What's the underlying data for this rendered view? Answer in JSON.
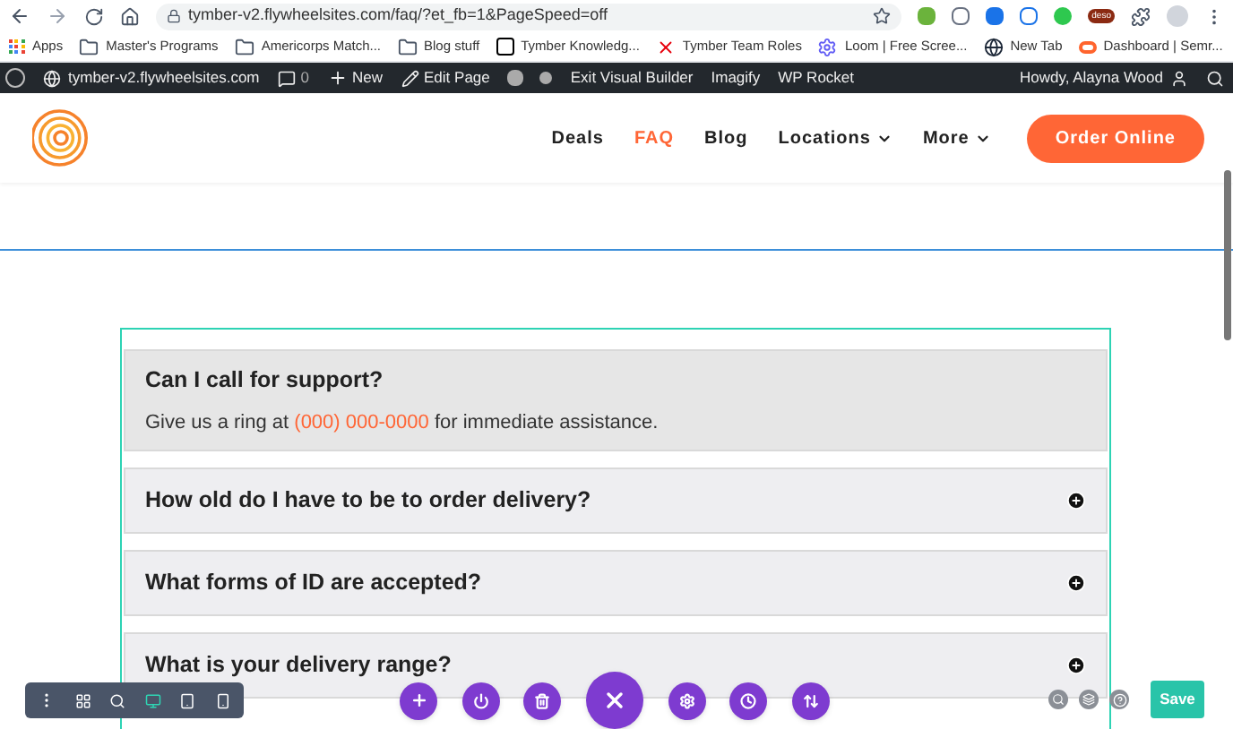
{
  "browser": {
    "url": "tymber-v2.flywheelsites.com/faq/?et_fb=1&PageSpeed=off",
    "extension_badge": "deso"
  },
  "bookmarks": [
    {
      "label": "Apps",
      "kind": "apps"
    },
    {
      "label": "Master's Programs",
      "kind": "folder"
    },
    {
      "label": "Americorps Match...",
      "kind": "folder"
    },
    {
      "label": "Blog stuff",
      "kind": "folder"
    },
    {
      "label": "Tymber Knowledg...",
      "kind": "notion"
    },
    {
      "label": "Tymber Team Roles",
      "kind": "site"
    },
    {
      "label": "Loom | Free Scree...",
      "kind": "loom"
    },
    {
      "label": "New Tab",
      "kind": "globe"
    },
    {
      "label": "Dashboard | Semr...",
      "kind": "semrush"
    }
  ],
  "admin_bar": {
    "site": "tymber-v2.flywheelsites.com",
    "comments": "0",
    "items": [
      {
        "label": "New",
        "kind": "new"
      },
      {
        "label": "Edit Page",
        "kind": "edit"
      },
      {
        "label": "Exit Visual Builder",
        "kind": "plain"
      },
      {
        "label": "Imagify",
        "kind": "plain"
      },
      {
        "label": "WP Rocket",
        "kind": "plain"
      }
    ],
    "greeting": "Howdy, Alayna Wood"
  },
  "nav": {
    "items": [
      {
        "label": "Deals",
        "selected": false,
        "dropdown": false
      },
      {
        "label": "FAQ",
        "selected": true,
        "dropdown": false
      },
      {
        "label": "Blog",
        "selected": false,
        "dropdown": false
      },
      {
        "label": "Locations",
        "selected": false,
        "dropdown": true
      },
      {
        "label": "More",
        "selected": false,
        "dropdown": true
      }
    ],
    "cta": "Order Online"
  },
  "faq": [
    {
      "question": "Can I call for support?",
      "expanded": true,
      "answer_before": "Give us a ring at ",
      "answer_link": "(000) 000-0000",
      "answer_after": " for immediate assistance."
    },
    {
      "question": "How old do I have to be to order delivery?",
      "expanded": false
    },
    {
      "question": "What forms of ID are accepted?",
      "expanded": false
    },
    {
      "question": "What is your delivery range?",
      "expanded": false
    }
  ],
  "builder": {
    "save": "Save"
  }
}
